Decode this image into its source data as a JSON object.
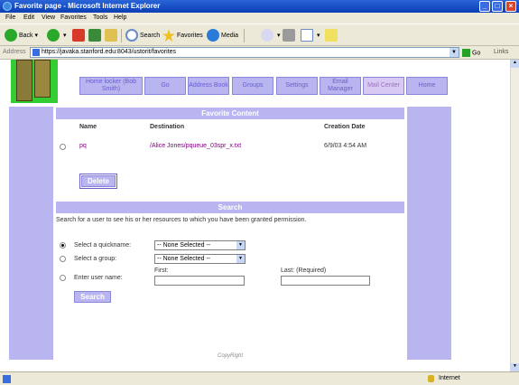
{
  "window": {
    "title": "Favorite page - Microsoft Internet Explorer"
  },
  "menu": [
    "File",
    "Edit",
    "View",
    "Favorites",
    "Tools",
    "Help"
  ],
  "toolbar": {
    "back": "Back",
    "search": "Search",
    "favorites": "Favorites",
    "media": "Media"
  },
  "address": {
    "label": "Address",
    "url": "https://javaka.stanford.edu:8043/ustorit/favorites",
    "go": "Go",
    "links": "Links"
  },
  "nav": [
    {
      "label": "Home locker (Bob Smith)"
    },
    {
      "label": "Go"
    },
    {
      "label": "Address Book"
    },
    {
      "label": "Groups"
    },
    {
      "label": "Settings"
    },
    {
      "label": "Email Manager"
    },
    {
      "label": "Mail Center"
    },
    {
      "label": "Home"
    }
  ],
  "favorites": {
    "title": "Favorite Content",
    "columns": [
      "Name",
      "Destination",
      "Creation Date"
    ],
    "rows": [
      {
        "name": "pq",
        "destination": "/Alice Jones/pqueue_03spr_x.txt",
        "date": "6/9/03 4:54 AM"
      }
    ],
    "delete_label": "Delete"
  },
  "search": {
    "title": "Search",
    "description": "Search for a user to see his or her resources to which you have been granted permission.",
    "quickname_label": "Select a quickname:",
    "quickname_value": "-- None Selected --",
    "group_label": "Select a group:",
    "group_value": "-- None Selected --",
    "username_label": "Enter user name:",
    "first_label": "First:",
    "last_label": "Last: (Required)",
    "search_button": "Search"
  },
  "footer": {
    "copyright": "CopyRight"
  },
  "status": {
    "zone": "Internet"
  },
  "colors": {
    "accent": "#b8b5f0",
    "link": "#800080"
  }
}
